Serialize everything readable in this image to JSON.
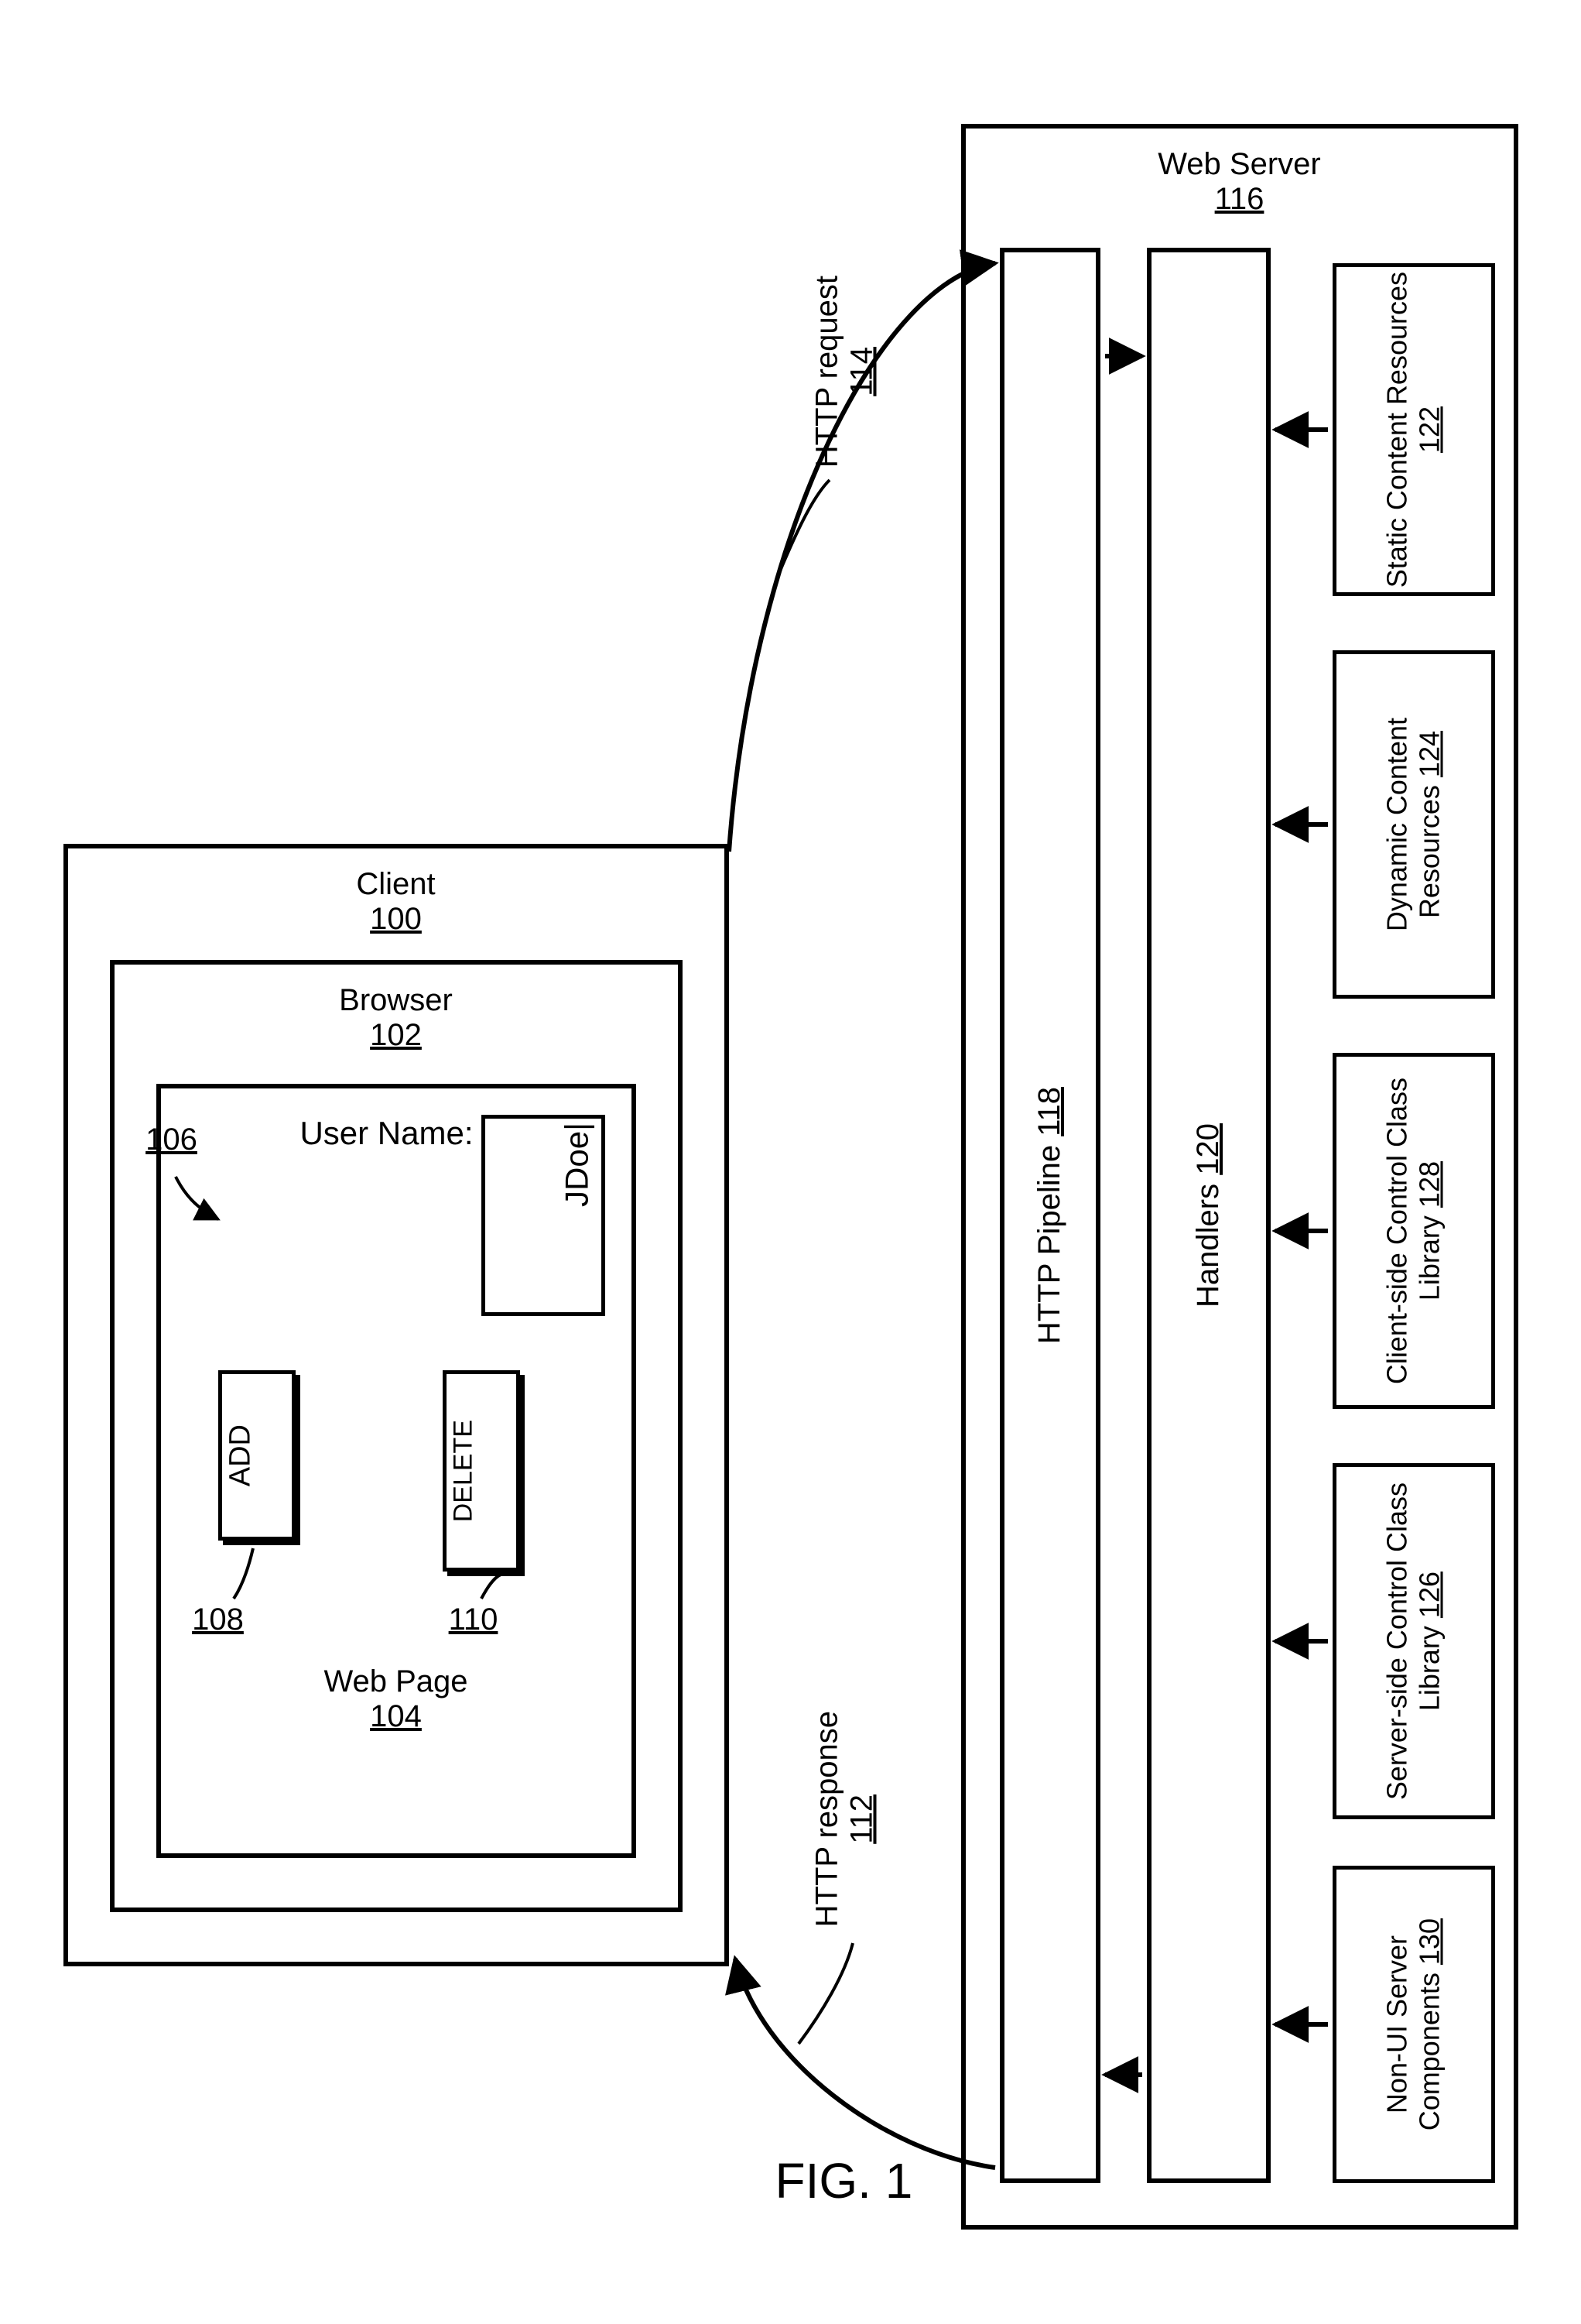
{
  "figure_caption": "FIG. 1",
  "client": {
    "title": "Client",
    "ref": "100",
    "browser": {
      "title": "Browser",
      "ref": "102"
    },
    "webpage": {
      "title": "Web Page",
      "ref": "104"
    },
    "username_label": "User Name:",
    "username_ref": "106",
    "username_value": "JDoe|",
    "add_label": "ADD",
    "add_ref": "108",
    "delete_label": "DELETE",
    "delete_ref": "110"
  },
  "http": {
    "request_label": "HTTP request",
    "request_ref": "114",
    "response_label": "HTTP response",
    "response_ref": "112"
  },
  "server": {
    "title": "Web Server",
    "ref": "116",
    "pipeline": {
      "title": "HTTP Pipeline",
      "ref": "118"
    },
    "handlers": {
      "title": "Handlers",
      "ref": "120"
    },
    "resources": [
      {
        "title": "Static Content Resources",
        "ref": "122"
      },
      {
        "title": "Dynamic Content Resources",
        "ref": "124"
      },
      {
        "title": "Client-side Control Class Library",
        "ref": "128"
      },
      {
        "title": "Server-side Control Class Library",
        "ref": "126"
      },
      {
        "title": "Non-UI Server Components",
        "ref": "130"
      }
    ]
  }
}
